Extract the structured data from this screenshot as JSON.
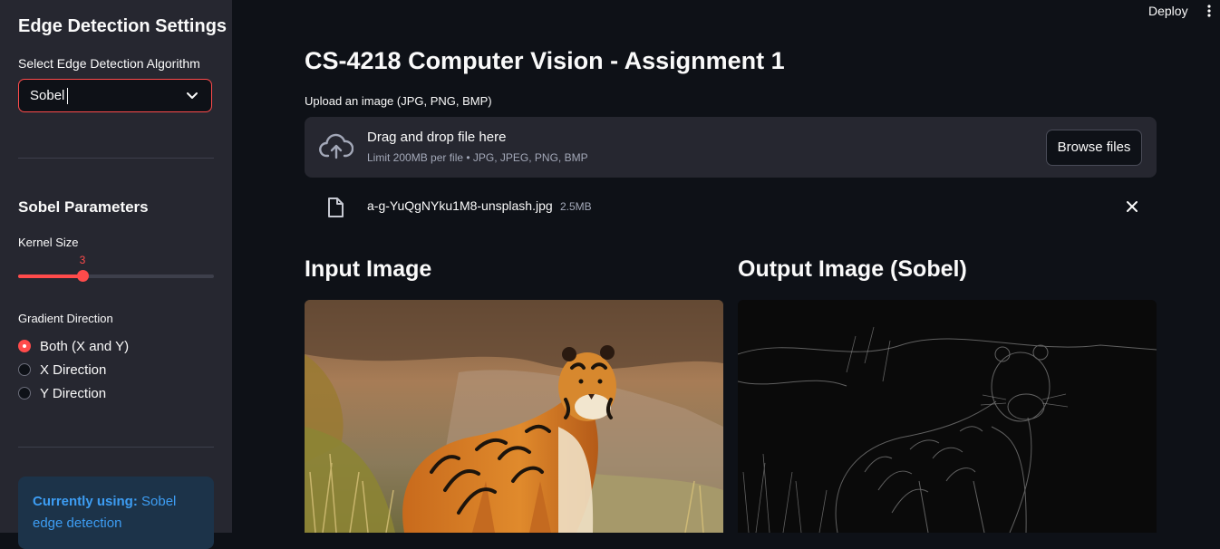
{
  "sidebar": {
    "title": "Edge Detection Settings",
    "algorithm_label": "Select Edge Detection Algorithm",
    "algorithm_value": "Sobel",
    "params_title": "Sobel Parameters",
    "kernel_label": "Kernel Size",
    "kernel_value": "3",
    "kernel_fraction": 0.33,
    "direction_label": "Gradient Direction",
    "directions": [
      {
        "label": "Both (X and Y)",
        "selected": true
      },
      {
        "label": "X Direction",
        "selected": false
      },
      {
        "label": "Y Direction",
        "selected": false
      }
    ],
    "info_prefix": "Currently using:",
    "info_value": "Sobel edge detection"
  },
  "header": {
    "deploy_label": "Deploy"
  },
  "main": {
    "title": "CS-4218 Computer Vision - Assignment 1",
    "upload_label": "Upload an image (JPG, PNG, BMP)",
    "dropzone_title": "Drag and drop file here",
    "dropzone_limit": "Limit 200MB per file • JPG, JPEG, PNG, BMP",
    "browse_label": "Browse files",
    "file_name": "a-g-YuQgNYku1M8-unsplash.jpg",
    "file_size": "2.5MB",
    "input_heading": "Input Image",
    "output_heading": "Output Image (Sobel)"
  },
  "colors": {
    "accent": "#ff4b4b",
    "background": "#0e1117",
    "sidebar": "#262730",
    "info": "#3d9df3"
  }
}
